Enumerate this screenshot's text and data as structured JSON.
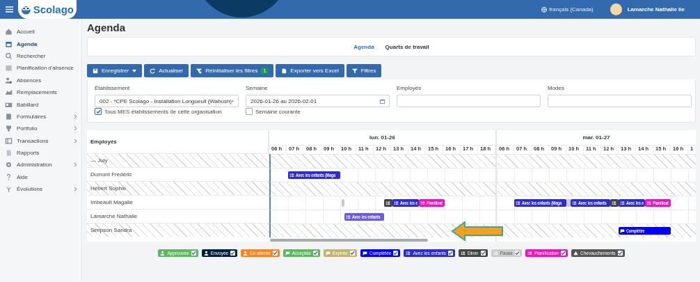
{
  "header": {
    "logo": "Scolago",
    "language": "français (Canada)",
    "user": "Lamarche Nathalie lie"
  },
  "sidebar": {
    "items": [
      {
        "label": "Accueil",
        "selected": false,
        "expandable": false
      },
      {
        "label": "Agenda",
        "selected": true,
        "expandable": false
      },
      {
        "label": "Rechercher",
        "selected": false,
        "expandable": false
      },
      {
        "label": "Planification d'absence",
        "selected": false,
        "expandable": false
      },
      {
        "label": "Absences",
        "selected": false,
        "expandable": false
      },
      {
        "label": "Remplacements",
        "selected": false,
        "expandable": false
      },
      {
        "label": "Babillard",
        "selected": false,
        "expandable": false
      },
      {
        "label": "Formulaires",
        "selected": false,
        "expandable": true
      },
      {
        "label": "Portfolio",
        "selected": false,
        "expandable": true
      },
      {
        "label": "Transactions",
        "selected": false,
        "expandable": true
      },
      {
        "label": "Rapports",
        "selected": false,
        "expandable": false
      },
      {
        "label": "Administration",
        "selected": false,
        "expandable": true
      },
      {
        "label": "Aide",
        "selected": false,
        "expandable": false
      },
      {
        "label": "Évolutions",
        "selected": false,
        "expandable": true
      }
    ]
  },
  "page_title": "Agenda",
  "tabs": [
    {
      "label": "Agenda",
      "selected": true
    },
    {
      "label": "Quarts de travail",
      "selected": false
    }
  ],
  "toolbar": [
    {
      "label": "Enregistrer",
      "kind": "save"
    },
    {
      "label": "Actualiser",
      "kind": "refresh"
    },
    {
      "label": "Réinitialiser les filtres",
      "kind": "reset",
      "badge": "1"
    },
    {
      "label": "Exporter vers Excel",
      "kind": "export"
    },
    {
      "label": "Filtres",
      "kind": "filter"
    }
  ],
  "filters": [
    {
      "label": "Établissement",
      "kind": "select",
      "value": "002 - *CPE Scolago - Installation Longueuil (Wabush)",
      "checkbox": {
        "label": "Tous MES établissements de cette organisation",
        "checked": true
      }
    },
    {
      "label": "Semaine",
      "kind": "date",
      "value": "2026-01-26 au 2026-02-01",
      "checkbox": {
        "label": "Semaine courante",
        "checked": false
      }
    },
    {
      "label": "Employés",
      "kind": "text"
    },
    {
      "label": "Modes",
      "kind": "text"
    }
  ],
  "gantt": {
    "employee_header": "Employés",
    "days": [
      {
        "label": "lun. 01-26",
        "hours": [
          "06 h",
          "07 h",
          "08 h",
          "09 h",
          "10 h",
          "11 h",
          "12 h",
          "13 h",
          "14 h",
          "15 h",
          "16 h",
          "17 h",
          "18 h"
        ]
      },
      {
        "label": "mar. 01-27",
        "hours": [
          "06 h",
          "07 h",
          "08 h",
          "09 h",
          "10 h",
          "11 h",
          "12 h",
          "13 h",
          "14 h",
          "15 h",
          "16 h",
          "1"
        ]
      }
    ],
    "rows": [
      {
        "name": "--- July",
        "hatched": true
      },
      {
        "name": "Dumont Frédéric",
        "hatched": false,
        "events": [
          {
            "kind": "list",
            "label": "Avec les enfants (Maga",
            "color": "#2c2cd2"
          }
        ]
      },
      {
        "name": "Hébert Sophie",
        "hatched": true
      },
      {
        "name": "Imbeault Magalie",
        "hatched": false,
        "events": [
          {
            "kind": "handle",
            "color": "#c8c8c8"
          },
          {
            "kind": "list",
            "color": "#444444"
          },
          {
            "kind": "list",
            "label": "Avec les e",
            "color": "#2c2cd2"
          },
          {
            "kind": "list",
            "label": "Planificat",
            "color": "#f012be"
          },
          {
            "kind": "list",
            "label": "Avec les enfants (Maga",
            "color": "#2c2cd2"
          },
          {
            "kind": "handle",
            "color": "#c8c8c8"
          },
          {
            "kind": "list",
            "label": "Avec les enfants",
            "color": "#2c2cd2"
          },
          {
            "kind": "list",
            "color": "#444444"
          },
          {
            "kind": "list",
            "label": "Avec les e",
            "color": "#2c2cd2"
          },
          {
            "kind": "list",
            "label": "Planificat",
            "color": "#f012be"
          }
        ]
      },
      {
        "name": "Lamarche Nathalie",
        "hatched": false,
        "events": [
          {
            "kind": "list",
            "label": "Avec les enfants",
            "color": "#6a5ae2"
          }
        ]
      },
      {
        "name": "Simpson Sandra",
        "hatched": true,
        "events": [
          {
            "kind": "bubble",
            "label": "Complétée",
            "color": "#0000ff"
          }
        ]
      }
    ]
  },
  "legend": [
    {
      "label": "Approuvée",
      "kind": "person",
      "color": "#5cb85c",
      "checked": true
    },
    {
      "label": "Envoyée",
      "kind": "person",
      "color": "#001f3f",
      "checked": true
    },
    {
      "label": "En attente",
      "kind": "person",
      "color": "#ff851b",
      "checked": true
    },
    {
      "label": "Acceptée",
      "kind": "bubble",
      "color": "#5cb85c",
      "checked": true
    },
    {
      "label": "Expirée",
      "kind": "bubble",
      "color": "#c2b56b",
      "checked": true
    },
    {
      "label": "Complétée",
      "kind": "bubble",
      "color": "#0000ff",
      "checked": true
    },
    {
      "label": "Avec les enfants",
      "kind": "list",
      "color": "#2c2cd2",
      "checked": true
    },
    {
      "label": "Diner",
      "kind": "list",
      "color": "#444444",
      "checked": true
    },
    {
      "label": "Pause",
      "kind": "list",
      "color": "#cccccc",
      "checked": true
    },
    {
      "label": "Planification",
      "kind": "list",
      "color": "#f012be",
      "checked": true
    },
    {
      "label": "Chevauchements",
      "kind": "warning",
      "color": "#555555",
      "checked": true
    }
  ]
}
